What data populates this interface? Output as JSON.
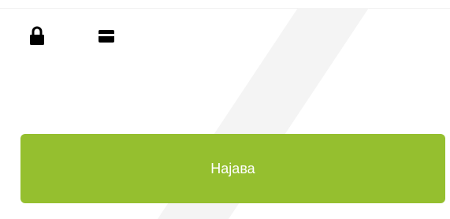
{
  "icons": {
    "lock": "lock-icon",
    "card": "credit-card-icon"
  },
  "login_button": {
    "label": "Најава"
  },
  "colors": {
    "accent": "#95bf2f",
    "button_text": "#ffffff",
    "icon": "#000000",
    "background_stripe": "#f3f3f3"
  }
}
